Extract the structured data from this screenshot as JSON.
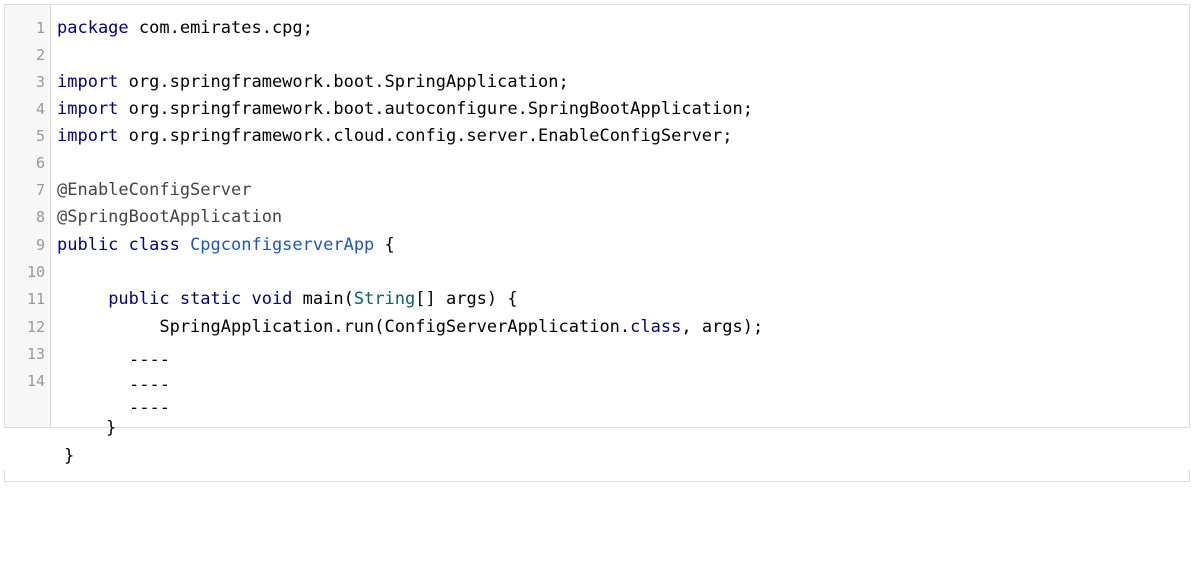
{
  "editor": {
    "lines": [
      {
        "n": "1",
        "parts": [
          [
            "kw",
            "package"
          ],
          [
            "plain",
            " com.emirates.cpg;"
          ]
        ]
      },
      {
        "n": "2",
        "parts": []
      },
      {
        "n": "3",
        "parts": [
          [
            "kw",
            "import"
          ],
          [
            "plain",
            " org.springframework.boot.SpringApplication;"
          ]
        ]
      },
      {
        "n": "4",
        "parts": [
          [
            "kw",
            "import"
          ],
          [
            "plain",
            " org.springframework.boot.autoconfigure.SpringBootApplication;"
          ]
        ]
      },
      {
        "n": "5",
        "parts": [
          [
            "kw",
            "import"
          ],
          [
            "plain",
            " org.springframework.cloud.config.server.EnableConfigServer;"
          ]
        ]
      },
      {
        "n": "6",
        "parts": []
      },
      {
        "n": "7",
        "parts": [
          [
            "ann",
            "@EnableConfigServer"
          ]
        ]
      },
      {
        "n": "8",
        "parts": [
          [
            "ann",
            "@SpringBootApplication"
          ]
        ]
      },
      {
        "n": "9",
        "parts": [
          [
            "kw",
            "public class "
          ],
          [
            "cls",
            "CpgconfigserverApp"
          ],
          [
            "plain",
            " {"
          ]
        ]
      },
      {
        "n": "10",
        "parts": []
      },
      {
        "n": "11",
        "parts": [
          [
            "plain",
            "     "
          ],
          [
            "kw",
            "public static void"
          ],
          [
            "plain",
            " main("
          ],
          [
            "str",
            "String"
          ],
          [
            "plain",
            "[] args) {"
          ]
        ]
      },
      {
        "n": "12",
        "parts": [
          [
            "plain",
            "          SpringApplication.run(ConfigServerApplication."
          ],
          [
            "kw",
            "class"
          ],
          [
            "plain",
            ", args);"
          ]
        ]
      },
      {
        "n": "13",
        "parts": []
      },
      {
        "n": "14",
        "parts": []
      }
    ],
    "dashes": [
      "----",
      "----",
      "----"
    ],
    "close_method": "}",
    "close_class": "}"
  },
  "colors": {
    "keyword": "#000088",
    "class_name": "#1a56c4",
    "type": "#006666",
    "annotation": "#444444"
  }
}
